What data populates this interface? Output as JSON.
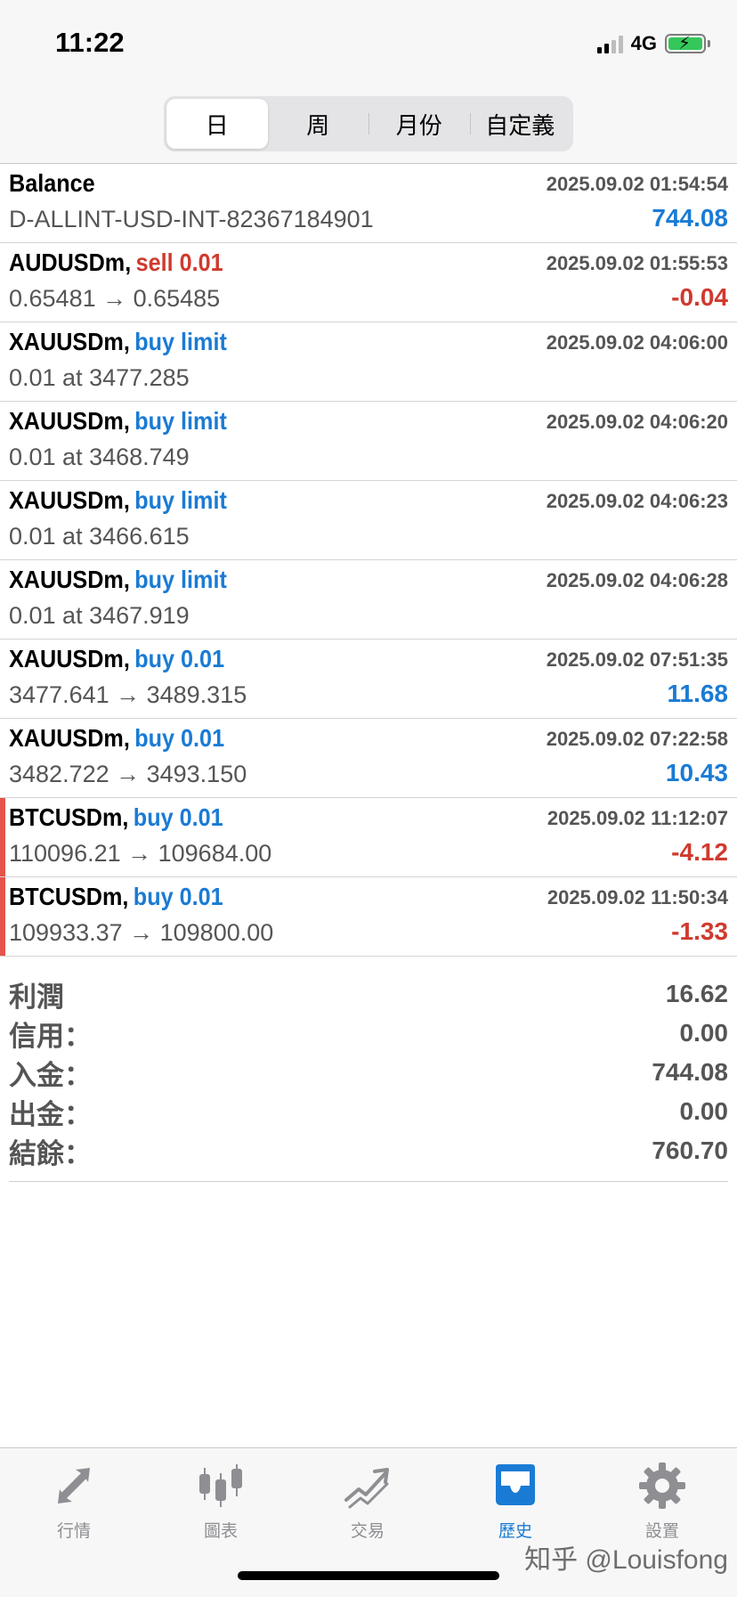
{
  "status": {
    "time": "11:22",
    "network": "4G"
  },
  "period_tabs": [
    {
      "label": "日",
      "active": true
    },
    {
      "label": "周",
      "active": false
    },
    {
      "label": "月份",
      "active": false
    },
    {
      "label": "自定義",
      "active": false
    }
  ],
  "deals": [
    {
      "symbol": "Balance",
      "side": "",
      "side_type": "",
      "time": "2025.09.02 01:54:54",
      "detail": "D-ALLINT-USD-INT-82367184901",
      "value": "744.08",
      "value_type": "pos",
      "marked": false
    },
    {
      "symbol": "AUDUSDm,",
      "side": "sell 0.01",
      "side_type": "sell",
      "time": "2025.09.02 01:55:53",
      "detail": "0.65481 → 0.65485",
      "value": "-0.04",
      "value_type": "neg",
      "marked": false
    },
    {
      "symbol": "XAUUSDm,",
      "side": "buy limit",
      "side_type": "buy",
      "time": "2025.09.02 04:06:00",
      "detail": "0.01 at 3477.285",
      "value": "",
      "value_type": "",
      "marked": false
    },
    {
      "symbol": "XAUUSDm,",
      "side": "buy limit",
      "side_type": "buy",
      "time": "2025.09.02 04:06:20",
      "detail": "0.01 at 3468.749",
      "value": "",
      "value_type": "",
      "marked": false
    },
    {
      "symbol": "XAUUSDm,",
      "side": "buy limit",
      "side_type": "buy",
      "time": "2025.09.02 04:06:23",
      "detail": "0.01 at 3466.615",
      "value": "",
      "value_type": "",
      "marked": false
    },
    {
      "symbol": "XAUUSDm,",
      "side": "buy limit",
      "side_type": "buy",
      "time": "2025.09.02 04:06:28",
      "detail": "0.01 at 3467.919",
      "value": "",
      "value_type": "",
      "marked": false
    },
    {
      "symbol": "XAUUSDm,",
      "side": "buy 0.01",
      "side_type": "buy",
      "time": "2025.09.02 07:51:35",
      "detail": "3477.641 → 3489.315",
      "value": "11.68",
      "value_type": "pos",
      "marked": false
    },
    {
      "symbol": "XAUUSDm,",
      "side": "buy 0.01",
      "side_type": "buy",
      "time": "2025.09.02 07:22:58",
      "detail": "3482.722 → 3493.150",
      "value": "10.43",
      "value_type": "pos",
      "marked": false
    },
    {
      "symbol": "BTCUSDm,",
      "side": "buy 0.01",
      "side_type": "buy",
      "time": "2025.09.02 11:12:07",
      "detail": "110096.21 → 109684.00",
      "value": "-4.12",
      "value_type": "neg",
      "marked": true
    },
    {
      "symbol": "BTCUSDm,",
      "side": "buy 0.01",
      "side_type": "buy",
      "time": "2025.09.02 11:50:34",
      "detail": "109933.37 → 109800.00",
      "value": "-1.33",
      "value_type": "neg",
      "marked": true
    }
  ],
  "summary": [
    {
      "label": "利潤",
      "value": "16.62"
    },
    {
      "label": "信用：",
      "value": "0.00"
    },
    {
      "label": "入金：",
      "value": "744.08"
    },
    {
      "label": "出金：",
      "value": "0.00"
    },
    {
      "label": "結餘：",
      "value": "760.70"
    }
  ],
  "tabbar": [
    {
      "label": "行情",
      "icon": "quotes-arrows-icon",
      "active": false
    },
    {
      "label": "圖表",
      "icon": "candlestick-chart-icon",
      "active": false
    },
    {
      "label": "交易",
      "icon": "trade-trend-icon",
      "active": false
    },
    {
      "label": "歷史",
      "icon": "history-inbox-icon",
      "active": true
    },
    {
      "label": "設置",
      "icon": "settings-gear-icon",
      "active": false
    }
  ],
  "watermark": "知乎 @Louisfong",
  "colors": {
    "buy": "#1a7bd4",
    "sell": "#d03a2e",
    "active_tab": "#1a7bd4",
    "inactive_icon": "#8e8e93"
  }
}
